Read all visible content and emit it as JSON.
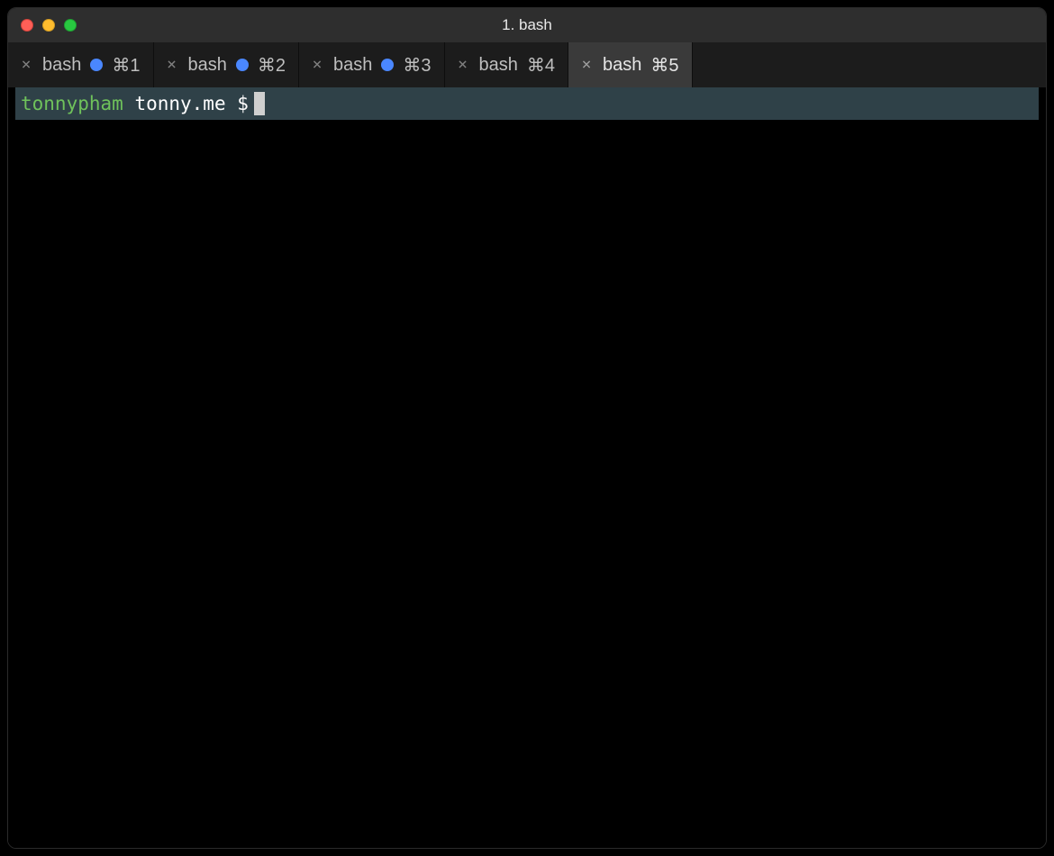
{
  "window": {
    "title": "1. bash"
  },
  "tabs": [
    {
      "label": "bash",
      "shortcut": "⌘1",
      "has_dot": true,
      "active": false
    },
    {
      "label": "bash",
      "shortcut": "⌘2",
      "has_dot": true,
      "active": false
    },
    {
      "label": "bash",
      "shortcut": "⌘3",
      "has_dot": true,
      "active": false
    },
    {
      "label": "bash",
      "shortcut": "⌘4",
      "has_dot": false,
      "active": false
    },
    {
      "label": "bash",
      "shortcut": "⌘5",
      "has_dot": false,
      "active": true
    }
  ],
  "prompt": {
    "user": "tonnypham",
    "host": "tonny.me",
    "symbol": "$"
  }
}
